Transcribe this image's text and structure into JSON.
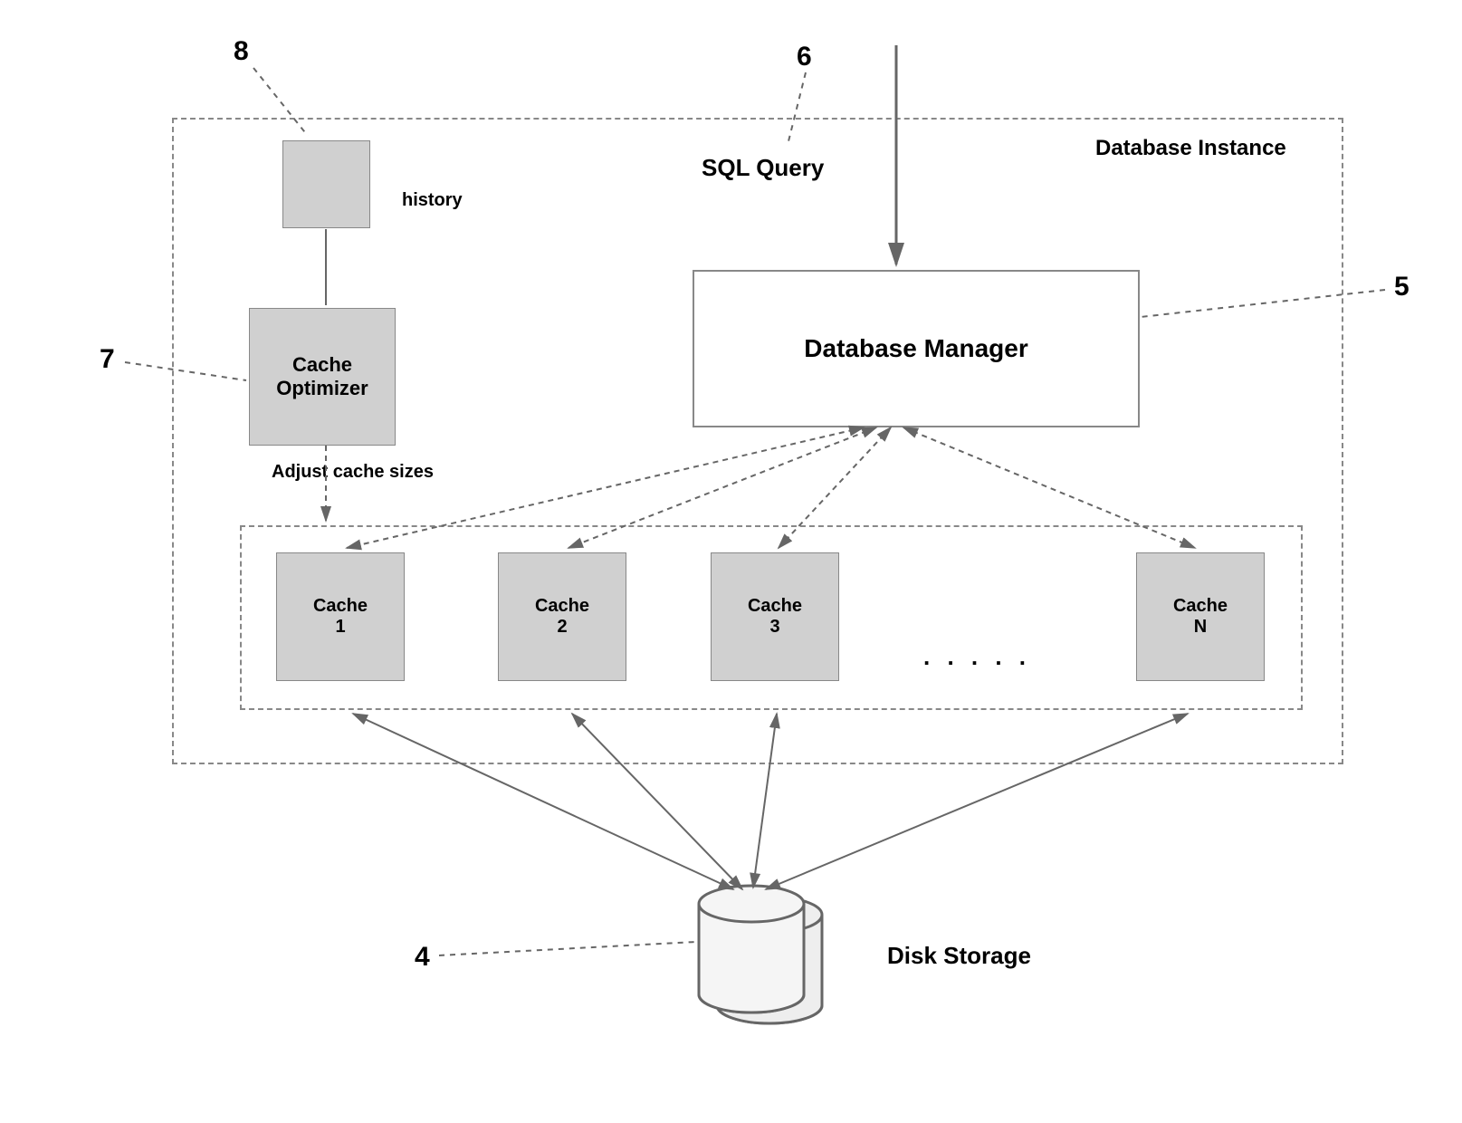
{
  "refs": {
    "r8": "8",
    "r6": "6",
    "r7": "7",
    "r5": "5",
    "r4": "4"
  },
  "labels": {
    "instance_title": "Database Instance",
    "history": "history",
    "sql_query": "SQL Query",
    "cache_optimizer": "Cache\nOptimizer",
    "adjust_cache": "Adjust cache sizes",
    "database_manager": "Database Manager",
    "cache1": "Cache\n1",
    "cache2": "Cache\n2",
    "cache3": "Cache\n3",
    "cacheN": "Cache\nN",
    "dots": ". . . . .",
    "disk_storage": "Disk Storage"
  }
}
